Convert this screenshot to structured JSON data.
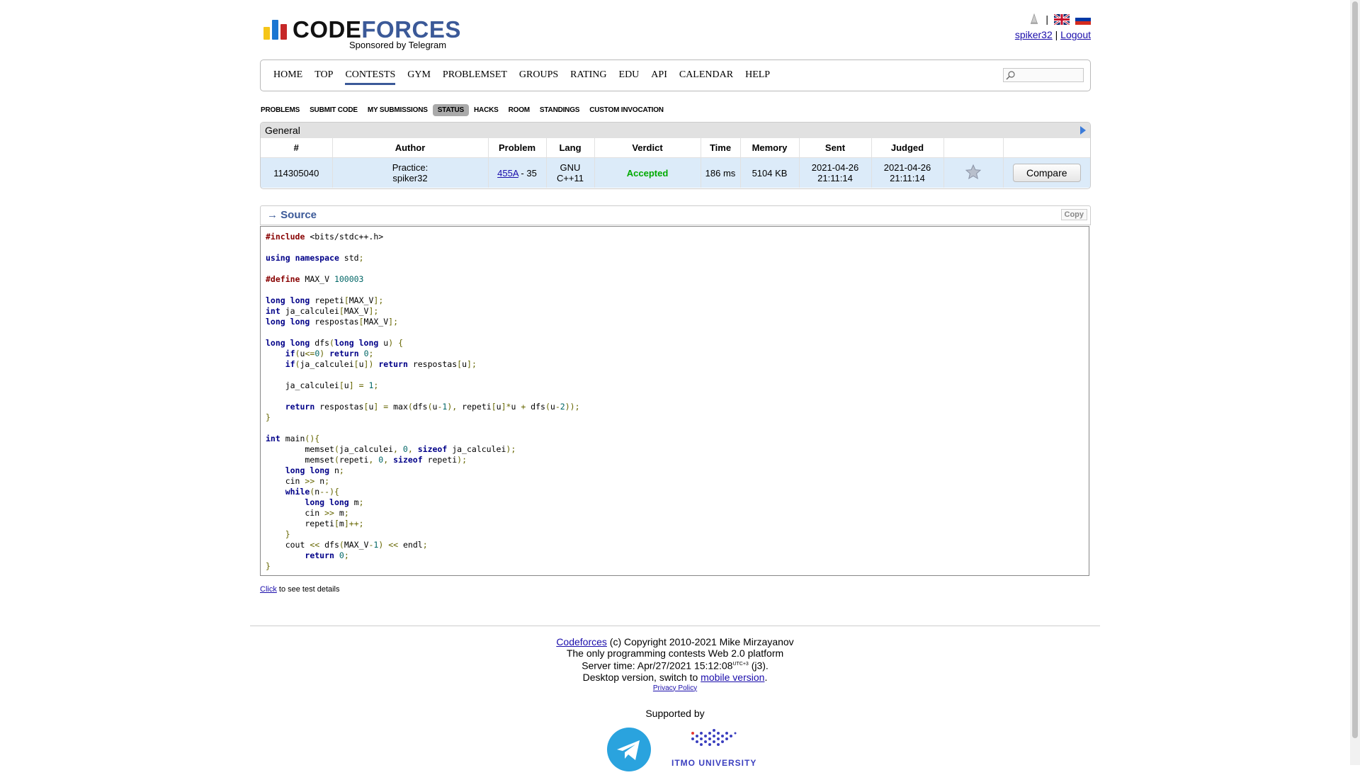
{
  "header": {
    "logo_word_a": "CODE",
    "logo_word_b": "FORCES",
    "logo_sub": "Sponsored by Telegram",
    "username": "spiker32",
    "separator": "|",
    "logout": "Logout"
  },
  "menu": {
    "items": [
      "HOME",
      "TOP",
      "CONTESTS",
      "GYM",
      "PROBLEMSET",
      "GROUPS",
      "RATING",
      "EDU",
      "API",
      "CALENDAR",
      "HELP"
    ],
    "active": "CONTESTS",
    "search_value": ""
  },
  "submenu": {
    "items": [
      "PROBLEMS",
      "SUBMIT CODE",
      "MY SUBMISSIONS",
      "STATUS",
      "HACKS",
      "ROOM",
      "STANDINGS",
      "CUSTOM INVOCATION"
    ],
    "active": "STATUS"
  },
  "status": {
    "caption": "General",
    "columns": [
      "#",
      "Author",
      "Problem",
      "Lang",
      "Verdict",
      "Time",
      "Memory",
      "Sent",
      "Judged",
      "",
      ""
    ],
    "row": {
      "id": "114305040",
      "author_line1": "Practice:",
      "author_line2": "spiker32",
      "problem_link": "455A",
      "problem_suffix": " - 35",
      "lang_line1": "GNU",
      "lang_line2": "C++11",
      "verdict": "Accepted",
      "time": "186 ms",
      "memory": "5104 KB",
      "sent_date": "2021-04-26",
      "sent_time": "21:11:14",
      "judged_date": "2021-04-26",
      "judged_time": "21:11:14",
      "compare": "Compare"
    }
  },
  "source": {
    "title": "→ Source",
    "copy": "Copy",
    "code": "#include <bits/stdc++.h>\n\nusing namespace std;\n\n#define MAX_V 100003\n\nlong long repeti[MAX_V];\nint ja_calculei[MAX_V];\nlong long respostas[MAX_V];\n\nlong long dfs(long long u) {\n    if(u<=0) return 0;\n    if(ja_calculei[u]) return respostas[u];\n\n    ja_calculei[u] = 1;\n\n    return respostas[u] = max(dfs(u-1), repeti[u]*u + dfs(u-2));\n}\n\nint main(){\n        memset(ja_calculei, 0, sizeof ja_calculei);\n        memset(repeti, 0, sizeof repeti);\n    long long n;\n    cin >> n;\n    while(n--){\n        long long m;\n        cin >> m;\n        repeti[m]++;\n    }\n    cout << dfs(MAX_V-1) << endl;\n        return 0;\n}"
  },
  "test_details": {
    "link": "Click",
    "text": " to see test details"
  },
  "footer": {
    "site_link": "Codeforces",
    "copyright": " (c) Copyright 2010-2021 Mike Mirzayanov",
    "tagline": "The only programming contests Web 2.0 platform",
    "server_time_label": "Server time: Apr/27/2021 15:12:08",
    "server_time_tz": "UTC+3",
    "server_time_suffix": " (j3).",
    "desktop_text": "Desktop version, switch to ",
    "mobile_link": "mobile version",
    "desktop_end": ".",
    "privacy": "Privacy Policy",
    "supported_by": "Supported by",
    "itmo": "ITMO UNIVERSITY"
  },
  "colors": {
    "brand_blue": "#3b5998",
    "accepted_green": "#00aa00",
    "row_highlight": "#dcebf9",
    "logo_yellow": "#f5c518",
    "logo_blue": "#1a76d2",
    "logo_red": "#c62828"
  }
}
